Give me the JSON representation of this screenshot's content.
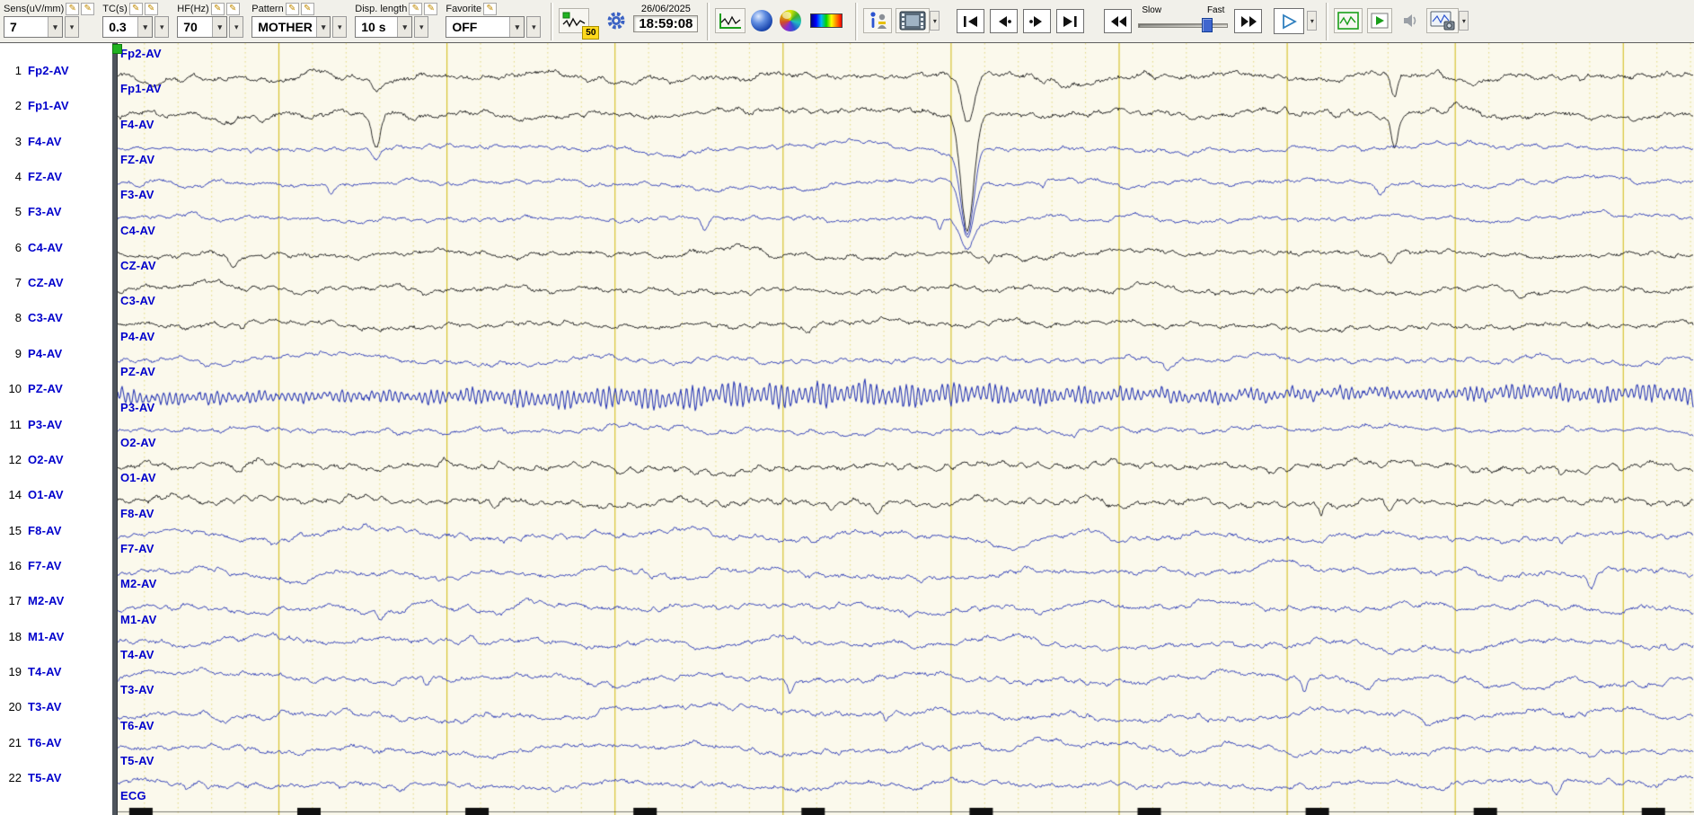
{
  "toolbar": {
    "groups": [
      {
        "label": "Sens(uV/mm)",
        "value": "7"
      },
      {
        "label": "TC(s)",
        "value": "0.3"
      },
      {
        "label": "HF(Hz)",
        "value": "70"
      },
      {
        "label": "Pattern",
        "value": "MOTHER"
      },
      {
        "label": "Disp. length",
        "value": "10 s"
      },
      {
        "label": "Favorite",
        "value": "OFF"
      }
    ],
    "badge_50": "50",
    "date": "26/06/2025",
    "time": "18:59:08",
    "slider": {
      "slow": "Slow",
      "fast": "Fast"
    }
  },
  "icons": {
    "dropdown": "▾",
    "pencil": "✎"
  },
  "colors": {
    "plot_bg": "#fbf9ec",
    "grid_major": "#d7c433",
    "grid_minor": "#e2d87c",
    "trace_black": "#161616",
    "trace_blue": "#2b3ab5",
    "label_blue": "#0000cc"
  },
  "channels": [
    {
      "num": "1",
      "label": "Fp2-AV",
      "c": "k",
      "wave": "frontal_k"
    },
    {
      "num": "2",
      "label": "Fp1-AV",
      "c": "k",
      "wave": "frontal_k"
    },
    {
      "num": "3",
      "label": "F4-AV",
      "c": "b",
      "wave": "frontal_b"
    },
    {
      "num": "4",
      "label": "FZ-AV",
      "c": "b",
      "wave": "frontal_b"
    },
    {
      "num": "5",
      "label": "F3-AV",
      "c": "b",
      "wave": "frontal_b"
    },
    {
      "num": "6",
      "label": "C4-AV",
      "c": "k",
      "wave": "central_k"
    },
    {
      "num": "7",
      "label": "CZ-AV",
      "c": "k",
      "wave": "central_k"
    },
    {
      "num": "8",
      "label": "C3-AV",
      "c": "k",
      "wave": "central_k"
    },
    {
      "num": "9",
      "label": "P4-AV",
      "c": "b",
      "wave": "parietal_b"
    },
    {
      "num": "10",
      "label": "PZ-AV",
      "c": "b",
      "wave": "dense"
    },
    {
      "num": "11",
      "label": "P3-AV",
      "c": "b",
      "wave": "parietal_b"
    },
    {
      "num": "12",
      "label": "O2-AV",
      "c": "k",
      "wave": "occipital_k"
    },
    {
      "num": "14",
      "label": "O1-AV",
      "c": "k",
      "wave": "occipital_k"
    },
    {
      "num": "15",
      "label": "F8-AV",
      "c": "b",
      "wave": "temporal_b"
    },
    {
      "num": "16",
      "label": "F7-AV",
      "c": "b",
      "wave": "temporal_b"
    },
    {
      "num": "17",
      "label": "M2-AV",
      "c": "b",
      "wave": "temporal_b"
    },
    {
      "num": "18",
      "label": "M1-AV",
      "c": "b",
      "wave": "temporal_b"
    },
    {
      "num": "19",
      "label": "T4-AV",
      "c": "b",
      "wave": "temporal_b"
    },
    {
      "num": "20",
      "label": "T3-AV",
      "c": "b",
      "wave": "temporal_b"
    },
    {
      "num": "21",
      "label": "T6-AV",
      "c": "b",
      "wave": "temporal_b"
    },
    {
      "num": "22",
      "label": "T5-AV",
      "c": "b",
      "wave": "temporal_b"
    },
    {
      "num": "",
      "label": "ECG",
      "c": "k",
      "wave": "ecg",
      "kind": "ecg"
    }
  ],
  "wave_presets": {
    "frontal_k": {
      "walk": 2.2,
      "slow": 2.0,
      "mid": 2.0,
      "fast": 1.2,
      "jit": 2.4,
      "spikes": 5
    },
    "frontal_b": {
      "walk": 1.6,
      "slow": 1.8,
      "mid": 1.6,
      "fast": 1.0,
      "jit": 1.8,
      "spikes": 3
    },
    "central_k": {
      "walk": 1.8,
      "slow": 1.5,
      "mid": 1.9,
      "fast": 1.3,
      "jit": 2.2,
      "spikes": 4
    },
    "parietal_b": {
      "walk": 1.6,
      "slow": 1.6,
      "mid": 1.8,
      "fast": 1.4,
      "jit": 2.0,
      "spikes": 3
    },
    "dense": {
      "walk": 1.4,
      "slow": 1.4,
      "mid": 1.5,
      "fast": 1.0,
      "jit": 1.8,
      "spikes": 0,
      "dense": true
    },
    "occipital_k": {
      "walk": 1.8,
      "slow": 1.7,
      "mid": 2.0,
      "fast": 1.9,
      "jit": 2.4,
      "spikes": 7
    },
    "temporal_b": {
      "walk": 2.4,
      "slow": 2.4,
      "mid": 1.8,
      "fast": 1.0,
      "jit": 1.9,
      "spikes": 5
    },
    "ecg": {
      "walk": 0.3,
      "slow": 0.3,
      "mid": 0.2,
      "fast": 0.2,
      "jit": 0.6,
      "spikes": 0
    }
  },
  "events": [
    {
      "x": 0.539,
      "sigma": 10,
      "amps": {
        "0": 55,
        "1": 130,
        "2": 95,
        "3": 60,
        "4": 28
      }
    },
    {
      "x": 0.164,
      "sigma": 7,
      "amps": {
        "0": 16,
        "1": 40,
        "2": 12
      }
    },
    {
      "x": 0.81,
      "sigma": 5,
      "amps": {
        "0": 26,
        "1": 30
      }
    }
  ]
}
